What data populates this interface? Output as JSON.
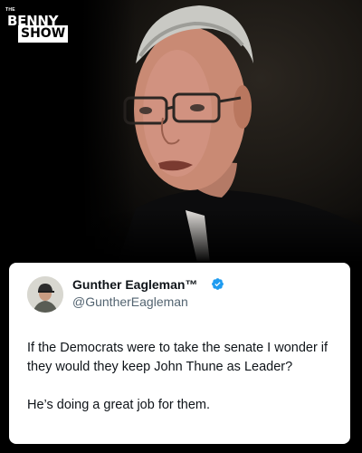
{
  "brand": {
    "small_text": "THE",
    "word1": "BENNY",
    "word2": "SHOW"
  },
  "tweet": {
    "display_name": "Gunther Eagleman™",
    "handle": "@GuntherEagleman",
    "verified": true,
    "paragraphs": [
      "If the Democrats were to take the senate I wonder if they would they keep John Thune as Leader?",
      "He’s doing a great job for them."
    ]
  },
  "colors": {
    "verified_badge": "#1d9bf0",
    "name_text": "#0f1419",
    "handle_text": "#536471",
    "card_bg": "#ffffff",
    "page_bg": "#000000"
  }
}
